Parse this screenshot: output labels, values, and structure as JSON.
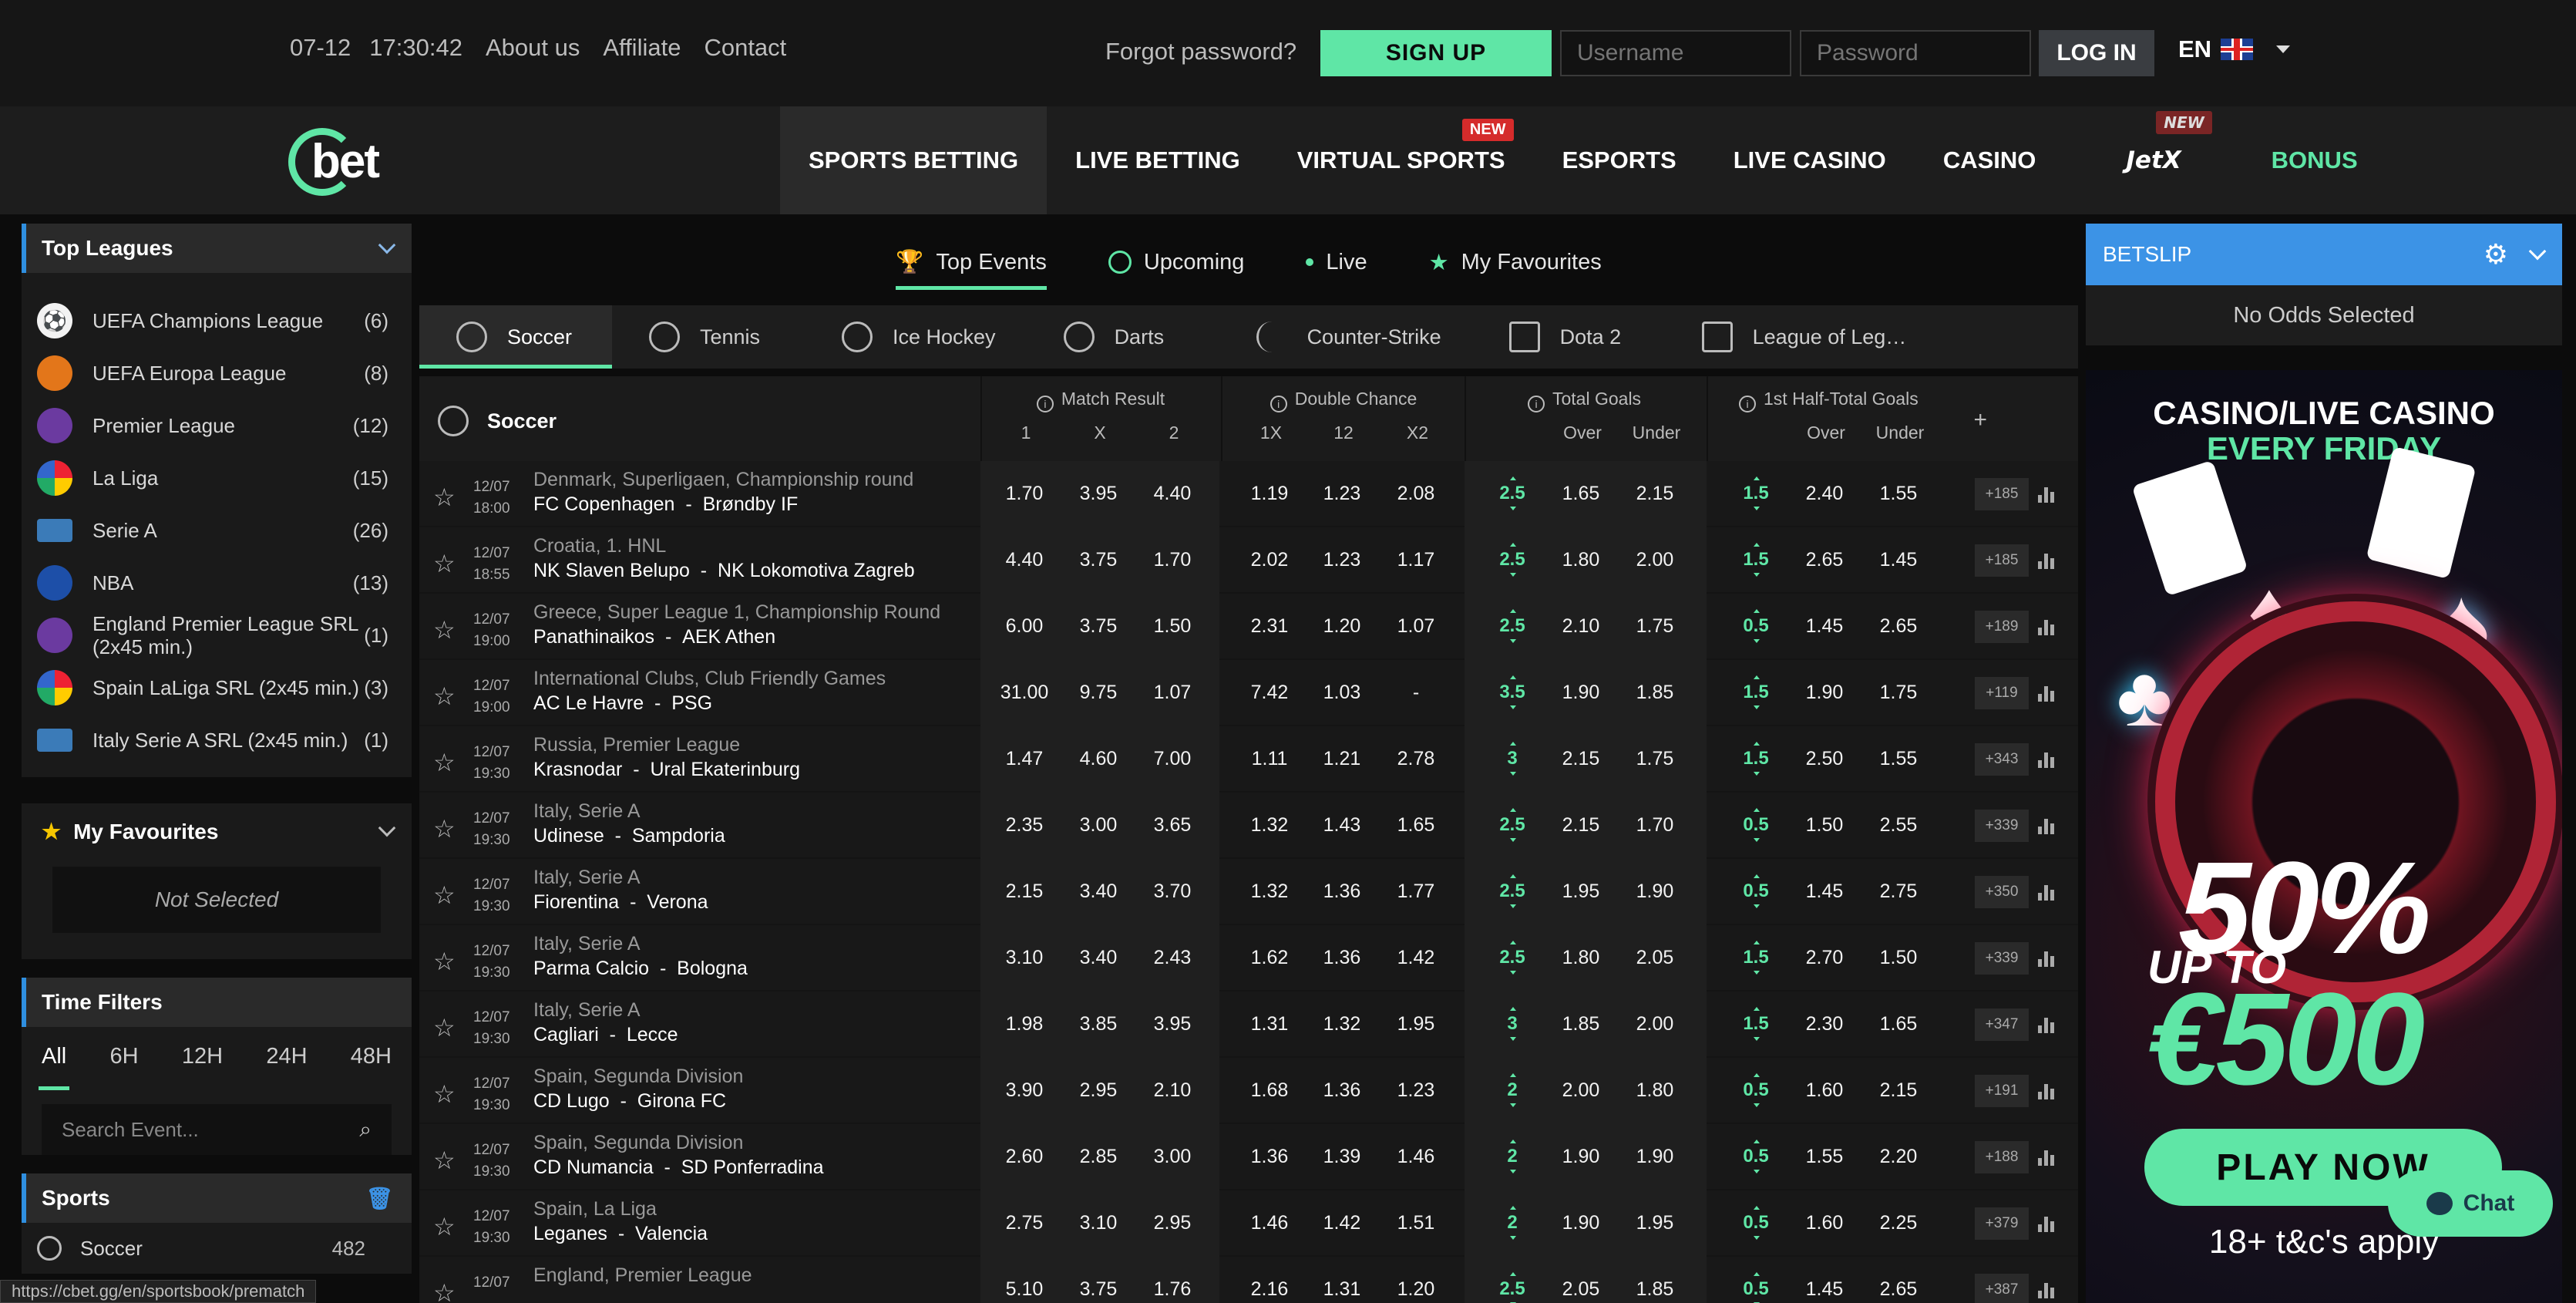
{
  "topbar": {
    "date": "07-12",
    "time": "17:30:42",
    "links": [
      "About us",
      "Affiliate",
      "Contact"
    ],
    "forgot": "Forgot password?",
    "signup": "SIGN UP",
    "username_placeholder": "Username",
    "password_placeholder": "Password",
    "login": "LOG IN",
    "lang": "EN"
  },
  "nav": {
    "logo": "bet",
    "items": [
      "SPORTS BETTING",
      "LIVE BETTING",
      "VIRTUAL SPORTS",
      "ESPORTS",
      "LIVE CASINO",
      "CASINO",
      "JetX",
      "BONUS"
    ],
    "new_badge": "NEW",
    "new_badge_jetx": "NEW"
  },
  "sidebar": {
    "top_leagues_title": "Top Leagues",
    "leagues": [
      {
        "name": "UEFA Champions League",
        "count": "(6)"
      },
      {
        "name": "UEFA Europa League",
        "count": "(8)"
      },
      {
        "name": "Premier League",
        "count": "(12)"
      },
      {
        "name": "La Liga",
        "count": "(15)"
      },
      {
        "name": "Serie A",
        "count": "(26)"
      },
      {
        "name": "NBA",
        "count": "(13)"
      },
      {
        "name": "England Premier League SRL (2x45 min.)",
        "count": "(1)"
      },
      {
        "name": "Spain LaLiga SRL (2x45 min.)",
        "count": "(3)"
      },
      {
        "name": "Italy Serie A SRL (2x45 min.)",
        "count": "(1)"
      }
    ],
    "favourites_title": "My Favourites",
    "favourites_empty": "Not Selected",
    "time_filters_title": "Time Filters",
    "time_filters": [
      "All",
      "6H",
      "12H",
      "24H",
      "48H"
    ],
    "search_placeholder": "Search Event...",
    "sports_title": "Sports",
    "sports": [
      {
        "name": "Soccer",
        "count": "482"
      }
    ]
  },
  "center": {
    "event_tabs": [
      "Top Events",
      "Upcoming",
      "Live",
      "My Favourites"
    ],
    "sport_tabs": [
      "Soccer",
      "Tennis",
      "Ice Hockey",
      "Darts",
      "Counter-Strike",
      "Dota 2",
      "League of Leg…"
    ],
    "table_sport": "Soccer",
    "markets": {
      "match_result": {
        "title": "Match Result",
        "cols": [
          "1",
          "X",
          "2"
        ]
      },
      "double_chance": {
        "title": "Double Chance",
        "cols": [
          "1X",
          "12",
          "X2"
        ]
      },
      "total_goals": {
        "title": "Total Goals",
        "cols": [
          "Over",
          "Under"
        ]
      },
      "half_total": {
        "title": "1st Half-Total Goals",
        "cols": [
          "Over",
          "Under"
        ]
      }
    },
    "plus": "+",
    "rows": [
      {
        "date": "12/07",
        "time": "18:00",
        "league": "Denmark, Superligaen, Championship round",
        "home": "FC Copenhagen",
        "away": "Brøndby IF",
        "mr": [
          "1.70",
          "3.95",
          "4.40"
        ],
        "dc": [
          "1.19",
          "1.23",
          "2.08"
        ],
        "tg_line": "2.5",
        "tg": [
          "1.65",
          "2.15"
        ],
        "ht_line": "1.5",
        "ht": [
          "2.40",
          "1.55"
        ],
        "more": "+185"
      },
      {
        "date": "12/07",
        "time": "18:55",
        "league": "Croatia, 1. HNL",
        "home": "NK Slaven Belupo",
        "away": "NK Lokomotiva Zagreb",
        "mr": [
          "4.40",
          "3.75",
          "1.70"
        ],
        "dc": [
          "2.02",
          "1.23",
          "1.17"
        ],
        "tg_line": "2.5",
        "tg": [
          "1.80",
          "2.00"
        ],
        "ht_line": "1.5",
        "ht": [
          "2.65",
          "1.45"
        ],
        "more": "+185"
      },
      {
        "date": "12/07",
        "time": "19:00",
        "league": "Greece, Super League 1, Championship Round",
        "home": "Panathinaikos",
        "away": "AEK Athen",
        "mr": [
          "6.00",
          "3.75",
          "1.50"
        ],
        "dc": [
          "2.31",
          "1.20",
          "1.07"
        ],
        "tg_line": "2.5",
        "tg": [
          "2.10",
          "1.75"
        ],
        "ht_line": "0.5",
        "ht": [
          "1.45",
          "2.65"
        ],
        "more": "+189"
      },
      {
        "date": "12/07",
        "time": "19:00",
        "league": "International Clubs, Club Friendly Games",
        "home": "AC Le Havre",
        "away": "PSG",
        "mr": [
          "31.00",
          "9.75",
          "1.07"
        ],
        "dc": [
          "7.42",
          "1.03",
          "-"
        ],
        "tg_line": "3.5",
        "tg": [
          "1.90",
          "1.85"
        ],
        "ht_line": "1.5",
        "ht": [
          "1.90",
          "1.75"
        ],
        "more": "+119"
      },
      {
        "date": "12/07",
        "time": "19:30",
        "league": "Russia, Premier League",
        "home": "Krasnodar",
        "away": "Ural Ekaterinburg",
        "mr": [
          "1.47",
          "4.60",
          "7.00"
        ],
        "dc": [
          "1.11",
          "1.21",
          "2.78"
        ],
        "tg_line": "3",
        "tg": [
          "2.15",
          "1.75"
        ],
        "ht_line": "1.5",
        "ht": [
          "2.50",
          "1.55"
        ],
        "more": "+343"
      },
      {
        "date": "12/07",
        "time": "19:30",
        "league": "Italy, Serie A",
        "home": "Udinese",
        "away": "Sampdoria",
        "mr": [
          "2.35",
          "3.00",
          "3.65"
        ],
        "dc": [
          "1.32",
          "1.43",
          "1.65"
        ],
        "tg_line": "2.5",
        "tg": [
          "2.15",
          "1.70"
        ],
        "ht_line": "0.5",
        "ht": [
          "1.50",
          "2.55"
        ],
        "more": "+339"
      },
      {
        "date": "12/07",
        "time": "19:30",
        "league": "Italy, Serie A",
        "home": "Fiorentina",
        "away": "Verona",
        "mr": [
          "2.15",
          "3.40",
          "3.70"
        ],
        "dc": [
          "1.32",
          "1.36",
          "1.77"
        ],
        "tg_line": "2.5",
        "tg": [
          "1.95",
          "1.90"
        ],
        "ht_line": "0.5",
        "ht": [
          "1.45",
          "2.75"
        ],
        "more": "+350"
      },
      {
        "date": "12/07",
        "time": "19:30",
        "league": "Italy, Serie A",
        "home": "Parma Calcio",
        "away": "Bologna",
        "mr": [
          "3.10",
          "3.40",
          "2.43"
        ],
        "dc": [
          "1.62",
          "1.36",
          "1.42"
        ],
        "tg_line": "2.5",
        "tg": [
          "1.80",
          "2.05"
        ],
        "ht_line": "1.5",
        "ht": [
          "2.70",
          "1.50"
        ],
        "more": "+339"
      },
      {
        "date": "12/07",
        "time": "19:30",
        "league": "Italy, Serie A",
        "home": "Cagliari",
        "away": "Lecce",
        "mr": [
          "1.98",
          "3.85",
          "3.95"
        ],
        "dc": [
          "1.31",
          "1.32",
          "1.95"
        ],
        "tg_line": "3",
        "tg": [
          "1.85",
          "2.00"
        ],
        "ht_line": "1.5",
        "ht": [
          "2.30",
          "1.65"
        ],
        "more": "+347"
      },
      {
        "date": "12/07",
        "time": "19:30",
        "league": "Spain, Segunda Division",
        "home": "CD Lugo",
        "away": "Girona FC",
        "mr": [
          "3.90",
          "2.95",
          "2.10"
        ],
        "dc": [
          "1.68",
          "1.36",
          "1.23"
        ],
        "tg_line": "2",
        "tg": [
          "2.00",
          "1.80"
        ],
        "ht_line": "0.5",
        "ht": [
          "1.60",
          "2.15"
        ],
        "more": "+191"
      },
      {
        "date": "12/07",
        "time": "19:30",
        "league": "Spain, Segunda Division",
        "home": "CD Numancia",
        "away": "SD Ponferradina",
        "mr": [
          "2.60",
          "2.85",
          "3.00"
        ],
        "dc": [
          "1.36",
          "1.39",
          "1.46"
        ],
        "tg_line": "2",
        "tg": [
          "1.90",
          "1.90"
        ],
        "ht_line": "0.5",
        "ht": [
          "1.55",
          "2.20"
        ],
        "more": "+188"
      },
      {
        "date": "12/07",
        "time": "19:30",
        "league": "Spain, La Liga",
        "home": "Leganes",
        "away": "Valencia",
        "mr": [
          "2.75",
          "3.10",
          "2.95"
        ],
        "dc": [
          "1.46",
          "1.42",
          "1.51"
        ],
        "tg_line": "2",
        "tg": [
          "1.90",
          "1.95"
        ],
        "ht_line": "0.5",
        "ht": [
          "1.60",
          "2.25"
        ],
        "more": "+379"
      },
      {
        "date": "12/07",
        "time": "",
        "league": "England, Premier League",
        "home": "",
        "away": "",
        "mr": [
          "5.10",
          "3.75",
          "1.76"
        ],
        "dc": [
          "2.16",
          "1.31",
          "1.20"
        ],
        "tg_line": "2.5",
        "tg": [
          "2.05",
          "1.85"
        ],
        "ht_line": "0.5",
        "ht": [
          "1.45",
          "2.65"
        ],
        "more": "+387"
      }
    ]
  },
  "betslip": {
    "title": "BETSLIP",
    "empty": "No Odds Selected"
  },
  "banner": {
    "line1": "CASINO/LIVE CASINO",
    "line2": "EVERY FRIDAY",
    "pct": "50%",
    "upto": "UP TO",
    "amount": "€500",
    "cta": "PLAY NOW",
    "tc": "18+ t&c's apply"
  },
  "chat": "Chat",
  "status_url": "https://cbet.gg/en/sportsbook/prematch",
  "colors": {
    "accent": "#5fe6a6",
    "blue": "#3c93e6",
    "badge_red": "#d52b2b"
  }
}
